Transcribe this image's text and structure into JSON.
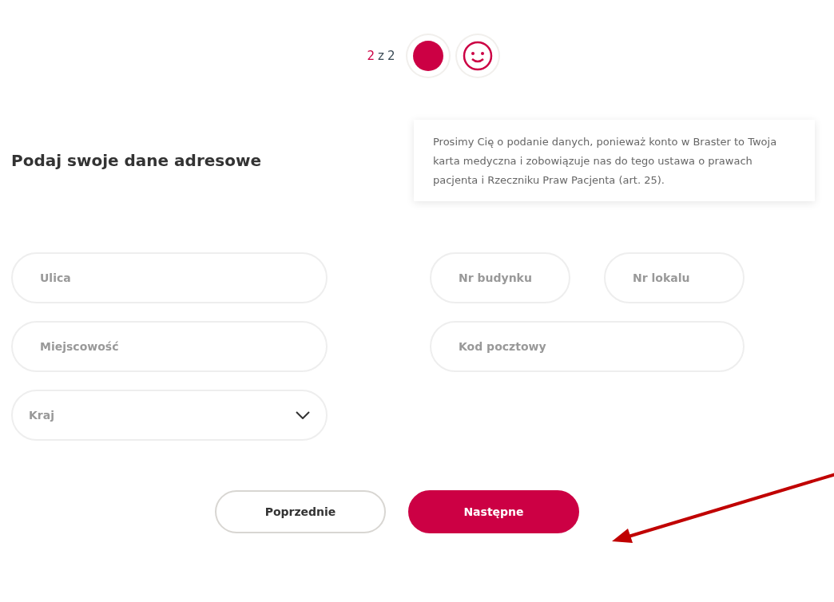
{
  "progress": {
    "current": "2",
    "separator": "z",
    "total": "2",
    "steps": [
      {
        "kind": "dot"
      },
      {
        "kind": "smiley"
      }
    ]
  },
  "heading": "Podaj swoje dane adresowe",
  "tooltip": "Prosimy Cię o podanie danych, ponieważ konto w Braster to Twoja karta medyczna i zobowiązuje nas do tego ustawa o prawach pacjenta i Rzeczniku Praw Pacjenta (art. 25).",
  "left_fields": [
    {
      "kind": "text",
      "placeholder": "Ulica"
    },
    {
      "kind": "text",
      "placeholder": "Miejscowość"
    },
    {
      "kind": "select",
      "placeholder": "Kraj"
    }
  ],
  "right_fields": [
    [
      {
        "kind": "text",
        "placeholder": "Nr budynku"
      },
      {
        "kind": "text",
        "placeholder": "Nr lokalu"
      }
    ],
    [
      {
        "kind": "text",
        "placeholder": "Kod pocztowy"
      }
    ]
  ],
  "buttons": [
    {
      "label": "Poprzednie",
      "kind": "secondary"
    },
    {
      "label": "Następne",
      "kind": "primary"
    }
  ],
  "annotation": {
    "kind": "arrow"
  }
}
